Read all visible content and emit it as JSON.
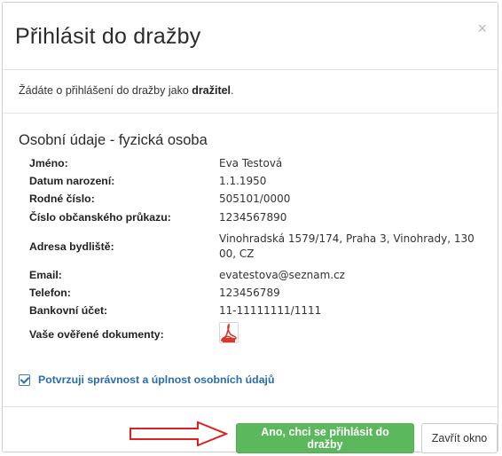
{
  "dialog": {
    "title": "Přihlásit do dražby",
    "close_label": "×",
    "intro_prefix": "Žádáte o přihlášení do dražby jako ",
    "intro_role": "dražitel",
    "intro_suffix": "."
  },
  "personal": {
    "section_title": "Osobní údaje - fyzická osoba",
    "rows": [
      {
        "label": "Jméno:",
        "value": "Eva Testová"
      },
      {
        "label": "Datum narození:",
        "value": "1.1.1950"
      },
      {
        "label": "Rodné číslo:",
        "value": "505101/0000"
      },
      {
        "label": "Číslo občanského průkazu:",
        "value": "1234567890"
      },
      {
        "label": "Adresa bydliště:",
        "value": "Vinohradská 1579/174, Praha 3, Vinohrady, 130 00, CZ"
      },
      {
        "label": "Email:",
        "value": "evatestova@seznam.cz"
      },
      {
        "label": "Telefon:",
        "value": "123456789"
      },
      {
        "label": "Bankovní účet:",
        "value": "11-11111111/1111"
      }
    ],
    "documents_label": "Vaše ověřené dokumenty:",
    "documents_icon": "pdf-icon"
  },
  "confirm": {
    "checked": true,
    "label": "Potvrzuji správnost a úplnost osobních údajů"
  },
  "footer": {
    "primary_button": "Ano, chci se přihlásit do dražby",
    "secondary_button": "Zavřít okno",
    "arrow_color": "#e02020"
  },
  "colors": {
    "primary": "#5cb85c",
    "link": "#2a6cad"
  }
}
